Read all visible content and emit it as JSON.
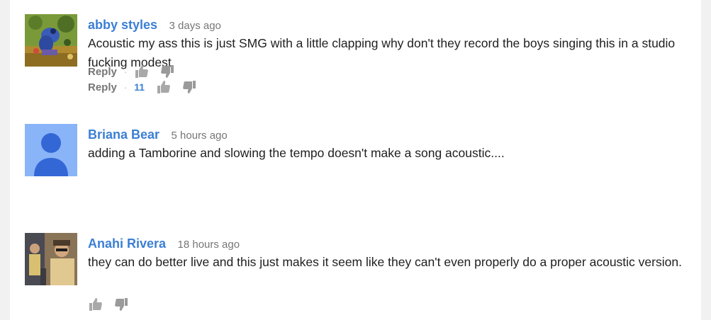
{
  "comments": [
    {
      "author": "abby styles",
      "time": "3 days ago",
      "text": "Acoustic my ass this is just SMG with a little clapping why don't they record the boys singing this in a studio fucking modest",
      "reply_label": "Reply",
      "separator": "·",
      "likes": "11"
    },
    {
      "author": "Briana Bear",
      "time": "5 hours ago",
      "text": "adding a Tamborine and slowing the tempo doesn't make a song acoustic....",
      "reply_label": "Reply",
      "separator": "·"
    },
    {
      "author": "Anahi Rivera",
      "time": "18 hours ago",
      "text": "they can do better live and this just makes it seem like they can't even properly do a proper acoustic version."
    }
  ],
  "colors": {
    "author_link": "#3b7fd4",
    "timestamp": "#767676",
    "default_avatar_bg": "#8ab4f8",
    "default_avatar_fg": "#3367d6"
  }
}
